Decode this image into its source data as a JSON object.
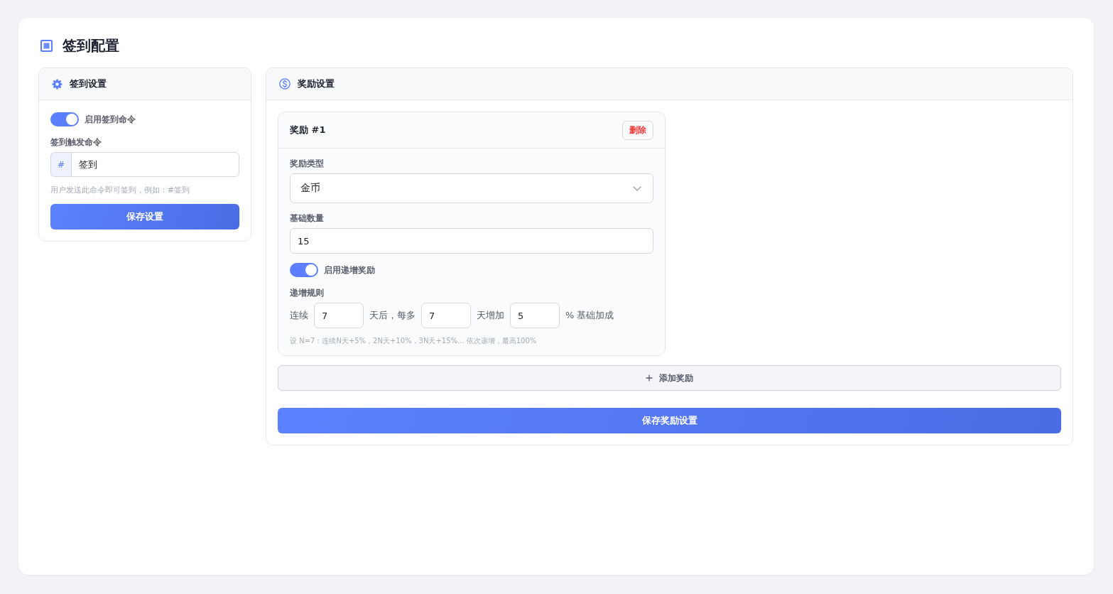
{
  "page_title": "签到配置",
  "checkin_settings": {
    "title": "签到设置",
    "enable_toggle": {
      "label": "启用签到命令",
      "on": true
    },
    "trigger_command": {
      "label": "签到触发命令",
      "prefix": "#",
      "value": "签到",
      "hint": "用户发送此命令即可签到，例如：#签到"
    },
    "save_button": "保存设置"
  },
  "reward_settings": {
    "title": "奖励设置",
    "rewards": [
      {
        "title": "奖励 #1",
        "delete_button": "删除",
        "reward_type": {
          "label": "奖励类型",
          "value": "金币"
        },
        "base_amount": {
          "label": "基础数量",
          "value": "15"
        },
        "incremental_toggle": {
          "label": "启用递增奖励",
          "on": true
        },
        "rule": {
          "label": "递增规则",
          "parts": [
            {
              "kind": "text",
              "text": "连续"
            },
            {
              "kind": "input",
              "value": "7"
            },
            {
              "kind": "text",
              "text": "天后，每多"
            },
            {
              "kind": "input",
              "value": "7"
            },
            {
              "kind": "text",
              "text": "天增加"
            },
            {
              "kind": "input",
              "value": "5"
            },
            {
              "kind": "text",
              "text": "% 基础加成"
            }
          ]
        },
        "hint": "设 N=7：连续N天+5%，2N天+10%，3N天+15%... 依次递增，最高100%"
      }
    ],
    "add_button": "添加奖励",
    "save_button": "保存奖励设置"
  }
}
